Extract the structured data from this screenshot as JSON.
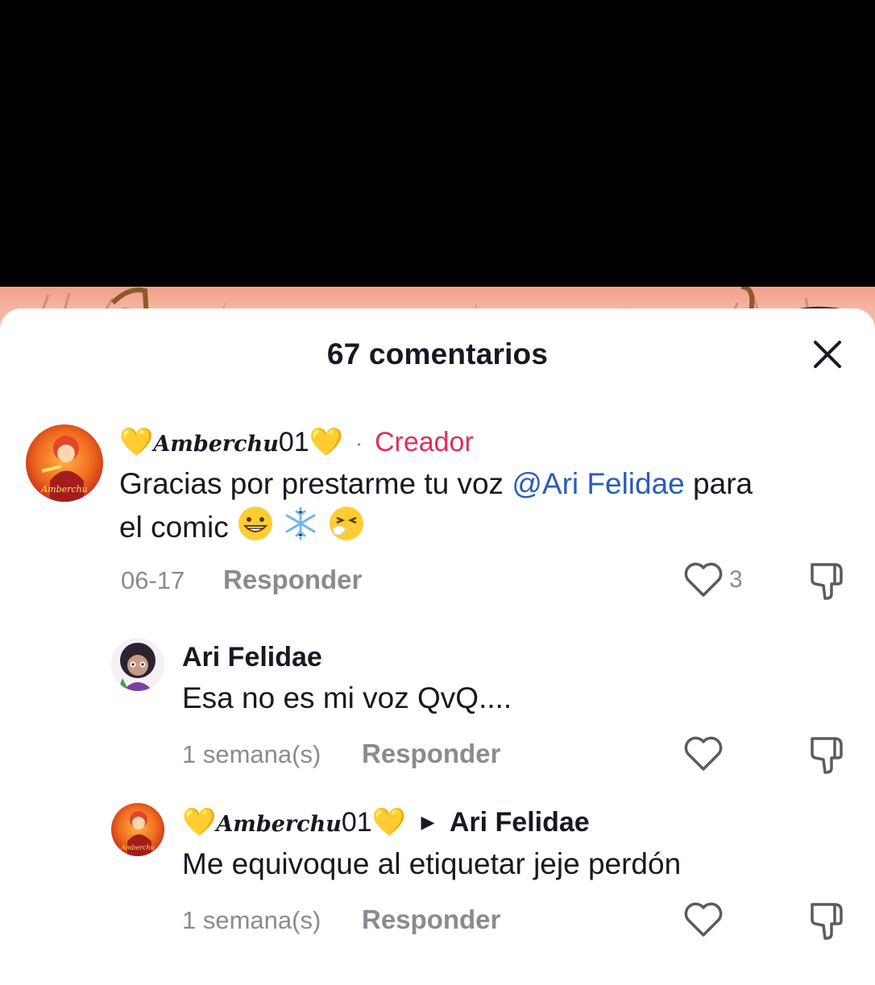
{
  "sheet": {
    "title": "67 comentarios"
  },
  "comments": [
    {
      "user_prefix": "💛",
      "user_script": "Amberchu",
      "user_num": "01",
      "user_suffix": "💛",
      "separator": "·",
      "badge": "Creador",
      "text_before": "Gracias por prestarme tu voz ",
      "mention": "@Ari Felidae",
      "text_after": " para",
      "text_line2": "el comic ",
      "emojis": [
        "grinning-face",
        "snowflake",
        "sneezing-face"
      ],
      "date": "06-17",
      "reply_label": "Responder",
      "likes": "3"
    },
    {
      "user": "Ari Felidae",
      "text": "Esa no es mi voz QvQ....",
      "date": "1 semana(s)",
      "reply_label": "Responder"
    },
    {
      "user_prefix": "💛",
      "user_script": "Amberchu",
      "user_num": "01",
      "user_suffix": "💛",
      "reply_to": "Ari Felidae",
      "text": "Me equivoque al etiquetar jeje perdón",
      "date": "1 semana(s)",
      "reply_label": "Responder"
    }
  ],
  "colors": {
    "creator": "#e0305a",
    "mention": "#2b5db9",
    "muted": "#8a8b91",
    "text": "#161823"
  }
}
